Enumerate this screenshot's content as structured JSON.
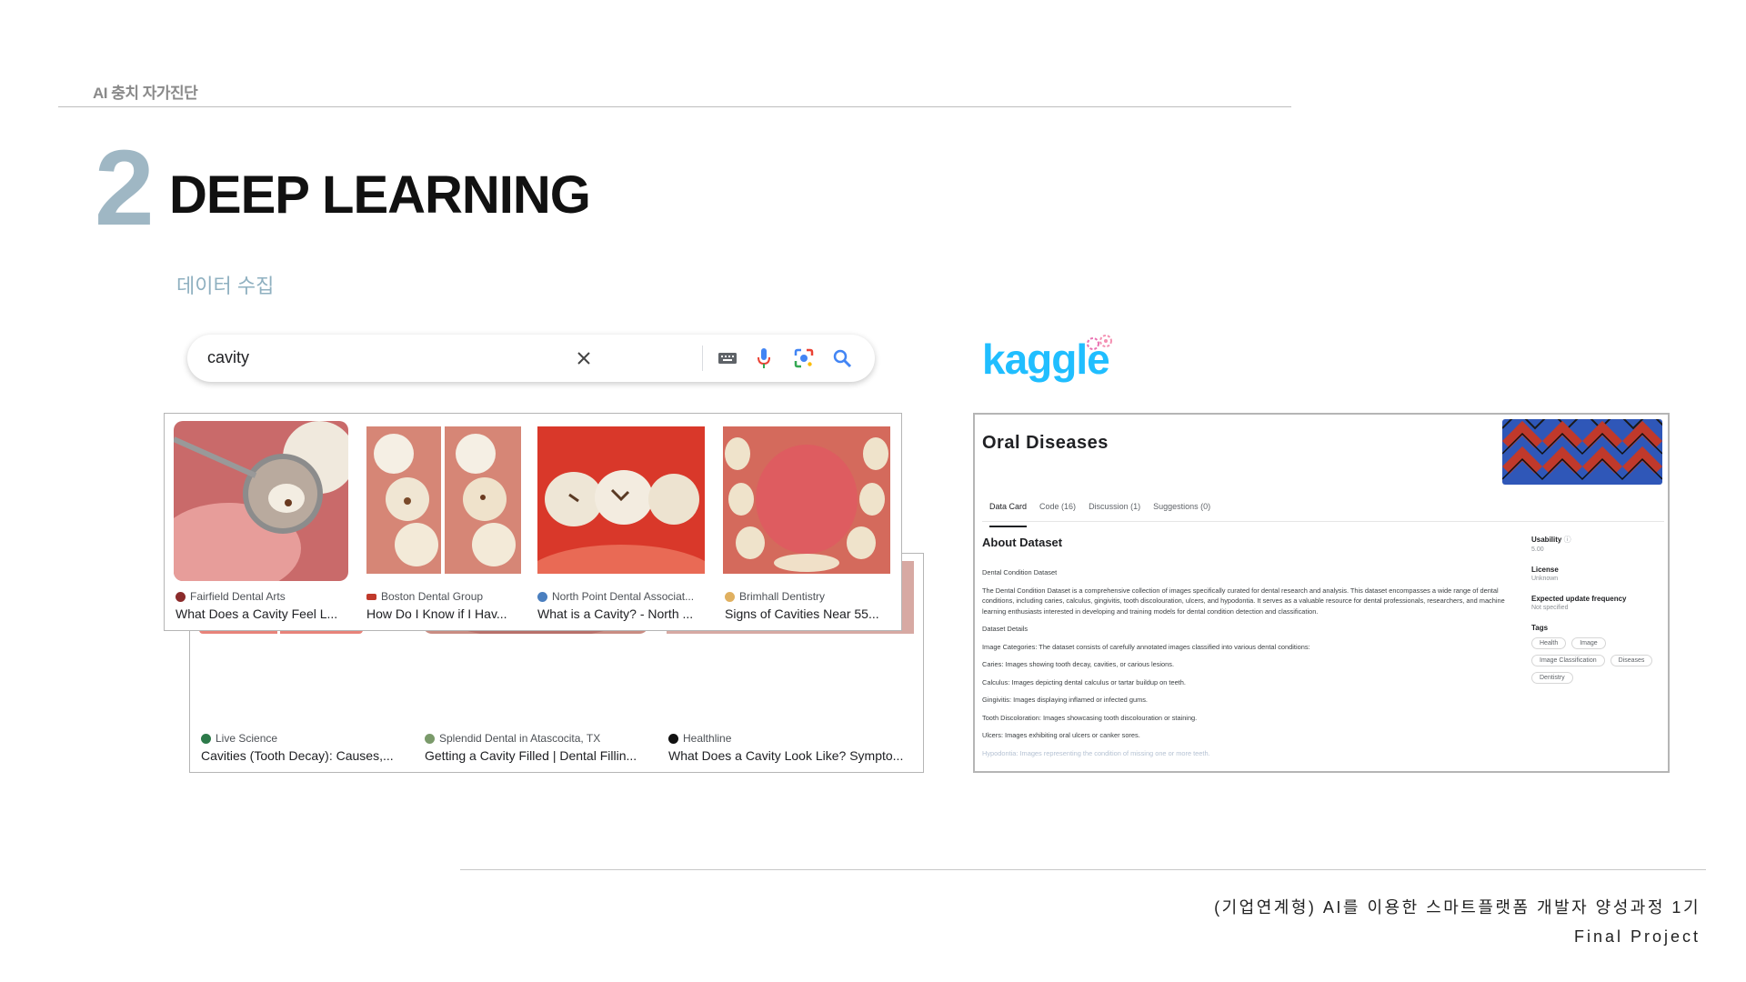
{
  "header": {
    "label": "AI 충치 자가진단",
    "section_number": "2",
    "section_title": "DEEP LEARNING",
    "subtitle": "데이터 수집"
  },
  "search": {
    "query": "cavity",
    "icons": [
      "close-icon",
      "keyboard-icon",
      "microphone-icon",
      "lens-icon",
      "search-icon"
    ]
  },
  "image_results": {
    "front": [
      {
        "source": "Fairfield Dental Arts",
        "title": "What Does a Cavity Feel L...",
        "favicon_color": "#8b2b2b"
      },
      {
        "source": "Boston Dental Group",
        "title": "How Do I Know if I Hav...",
        "favicon_color": "#c0392b"
      },
      {
        "source": "North Point Dental Associat...",
        "title": "What is a Cavity? - North ...",
        "favicon_color": "#4a7fbf"
      },
      {
        "source": "Brimhall Dentistry",
        "title": "Signs of Cavities Near 55...",
        "favicon_color": "#e0b060"
      }
    ],
    "back": [
      {
        "source": "Live Science",
        "title": "Cavities (Tooth Decay): Causes,...",
        "favicon_color": "#2d7a4a"
      },
      {
        "source": "Splendid Dental in Atascocita, TX",
        "title": "Getting a Cavity Filled | Dental Fillin...",
        "favicon_color": "#7a9a6a"
      },
      {
        "source": "Healthline",
        "title": "What Does a Cavity Look Like? Sympto...",
        "favicon_color": "#111111"
      }
    ]
  },
  "kaggle": {
    "logo": "kaggle",
    "brand_color": "#20beff",
    "dataset_title": "Oral Diseases",
    "tabs": [
      "Data Card",
      "Code (16)",
      "Discussion (1)",
      "Suggestions (0)"
    ],
    "about_heading": "About Dataset",
    "body": [
      "Dental Condition Dataset",
      "The Dental Condition Dataset is a comprehensive collection of images specifically curated for dental research and analysis. This dataset encompasses a wide range of dental conditions, including caries, calculus, gingivitis, tooth discolouration, ulcers, and hypodontia. It serves as a valuable resource for dental professionals, researchers, and machine learning enthusiasts interested in developing and training models for dental condition detection and classification.",
      "Dataset Details",
      "Image Categories: The dataset consists of carefully annotated images classified into various dental conditions:",
      "Caries: Images showing tooth decay, cavities, or carious lesions.",
      "Calculus: Images depicting dental calculus or tartar buildup on teeth.",
      "Gingivitis: Images displaying inflamed or infected gums.",
      "Tooth Discoloration: Images showcasing tooth discolouration or staining.",
      "Ulcers: Images exhibiting oral ulcers or canker sores."
    ],
    "faded_line": "Hypodontia: Images representing the condition of missing one or more teeth.",
    "usability_label": "Usability",
    "usability_value": "5.00",
    "license_label": "License",
    "license_value": "Unknown",
    "update_label": "Expected update frequency",
    "update_value": "Not specified",
    "tags_label": "Tags",
    "tags": [
      "Health",
      "Image",
      "Image Classification",
      "Diseases",
      "Dentistry"
    ]
  },
  "footer": {
    "line1": "(기업연계형) AI를 이용한 스마트플랫폼 개발자 양성과정 1기",
    "line2": "Final Project"
  }
}
